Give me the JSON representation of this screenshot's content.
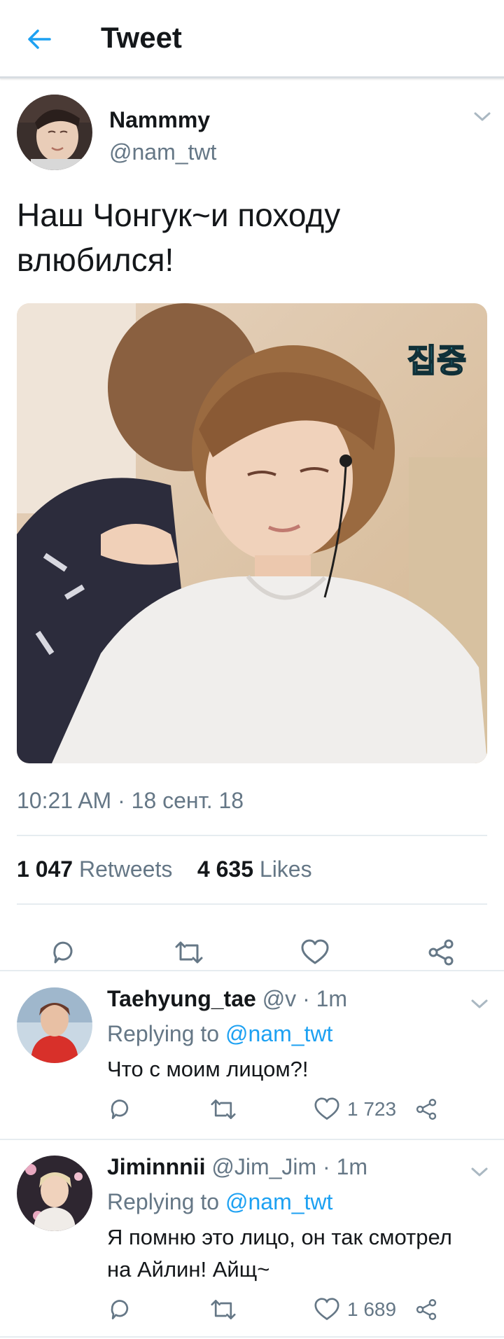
{
  "header": {
    "title": "Tweet",
    "back_icon": "arrow-left-icon",
    "accent_color": "#1da1f2"
  },
  "tweet": {
    "author_name": "Nammmy",
    "author_handle": "@nam_twt",
    "text": "Наш Чонгук~и походу влюбился!",
    "media_overlay_text": "집중",
    "timestamp": "10:21 AM · 18 сент. 18",
    "retweets_count": "1 047",
    "retweets_label": "Retweets",
    "likes_count": "4 635",
    "likes_label": "Likes",
    "actions": [
      "reply-icon",
      "retweet-icon",
      "like-icon",
      "share-icon"
    ]
  },
  "replies": [
    {
      "name": "Taehyung_tae",
      "meta": "@v · 1m",
      "replying_prefix": "Replying to",
      "mention": "@nam_twt",
      "text": "Что с моим лицом?!",
      "like_count": "1 723"
    },
    {
      "name": "Jiminnnii",
      "meta": "@Jim_Jim · 1m",
      "replying_prefix": "Replying to",
      "mention": "@nam_twt",
      "text": "Я помню это лицо, он так смотрел на Айлин! Айщ~",
      "like_count": "1 689"
    }
  ]
}
